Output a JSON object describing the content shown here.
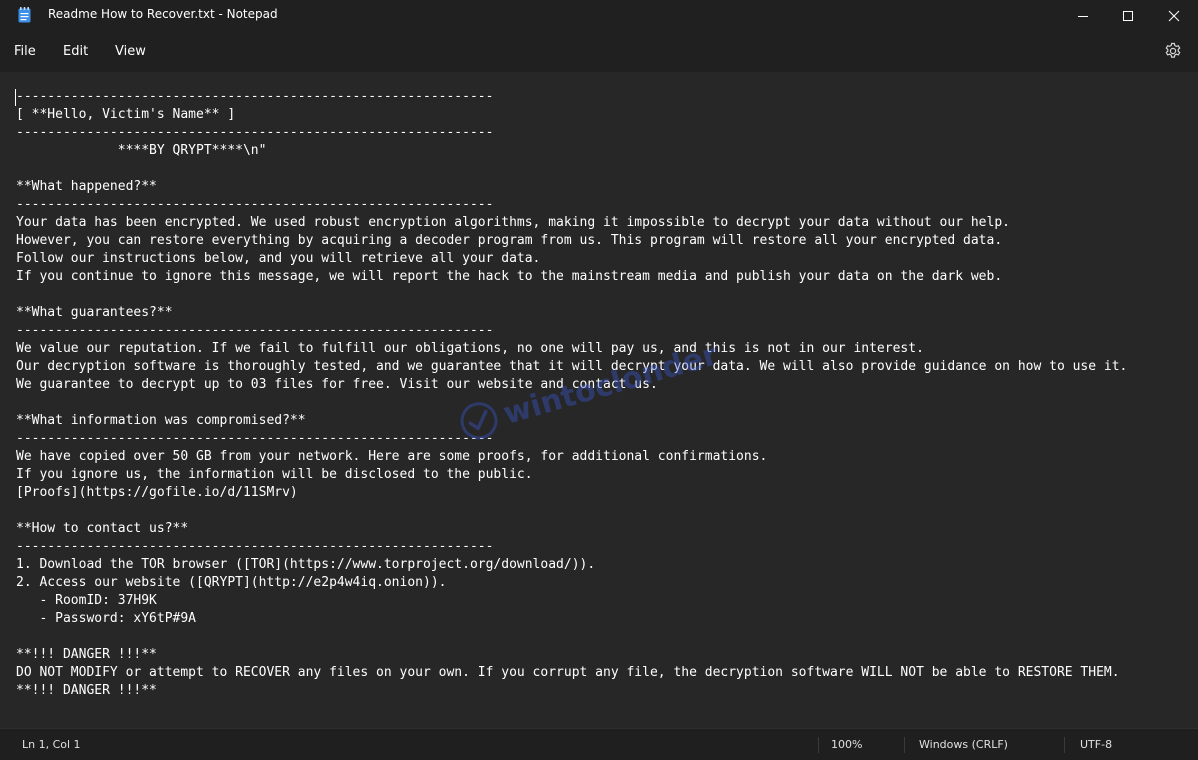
{
  "window": {
    "title": "Readme How to Recover.txt - Notepad"
  },
  "menu": {
    "file": "File",
    "edit": "Edit",
    "view": "View"
  },
  "icons": {
    "app": "notepad-icon",
    "minimize": "minimize-icon",
    "maximize": "maximize-icon",
    "close": "close-icon",
    "settings": "gear-icon"
  },
  "editor": {
    "content": "-------------------------------------------------------------\n[ **Hello, Victim's Name** ]\n-------------------------------------------------------------\n             ****BY QRYPT****\\n\"\n\n**What happened?**\n-------------------------------------------------------------\nYour data has been encrypted. We used robust encryption algorithms, making it impossible to decrypt your data without our help.\nHowever, you can restore everything by acquiring a decoder program from us. This program will restore all your encrypted data.\nFollow our instructions below, and you will retrieve all your data.\nIf you continue to ignore this message, we will report the hack to the mainstream media and publish your data on the dark web.\n\n**What guarantees?**\n-------------------------------------------------------------\nWe value our reputation. If we fail to fulfill our obligations, no one will pay us, and this is not in our interest.\nOur decryption software is thoroughly tested, and we guarantee that it will decrypt your data. We will also provide guidance on how to use it.\nWe guarantee to decrypt up to 03 files for free. Visit our website and contact us.\n\n**What information was compromised?**\n-------------------------------------------------------------\nWe have copied over 50 GB from your network. Here are some proofs, for additional confirmations.\nIf you ignore us, the information will be disclosed to the public.\n[Proofs](https://gofile.io/d/11SMrv)\n\n**How to contact us?**\n-------------------------------------------------------------\n1. Download the TOR browser ([TOR](https://www.torproject.org/download/)).\n2. Access our website ([QRYPT](http://e2p4w4iq.onion)).\n   - RoomID: 37H9K\n   - Password: xY6tP#9A\n\n**!!! DANGER !!!**\nDO NOT MODIFY or attempt to RECOVER any files on your own. If you corrupt any file, the decryption software WILL NOT be able to RESTORE THEM.\n**!!! DANGER !!!**"
  },
  "watermark": {
    "text": "wintoclonder"
  },
  "status": {
    "position": "Ln 1, Col 1",
    "zoom": "100%",
    "line_ending": "Windows (CRLF)",
    "encoding": "UTF-8"
  },
  "colors": {
    "background": "#272727",
    "chrome": "#202020",
    "text": "#ffffff",
    "watermark": "#3a5bd6"
  }
}
